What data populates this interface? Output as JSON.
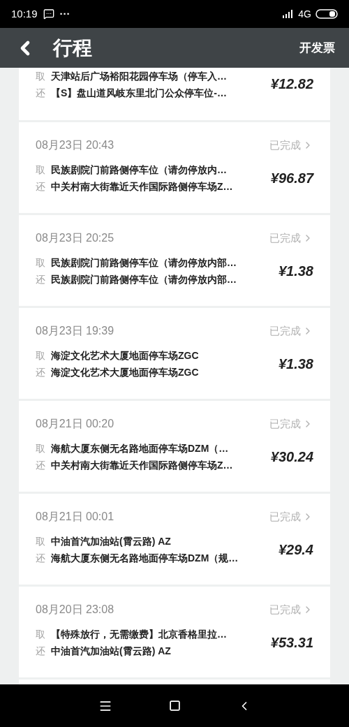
{
  "status_bar": {
    "time": "10:19",
    "more": "···",
    "network": "4G"
  },
  "header": {
    "title": "行程",
    "action": "开发票"
  },
  "first_card": {
    "pickup_label": "取",
    "pickup": "天津站后广场裕阳花园停车场（停车入…",
    "return_label": "还",
    "return": "【S】盘山道风岐东里北门公众停车位-…",
    "price": "¥12.82"
  },
  "trips": [
    {
      "date": "08月23日 20:43",
      "status": "已完成",
      "pickup_label": "取",
      "pickup": "民族剧院门前路侧停车位（请勿停放内…",
      "return_label": "还",
      "return": "中关村南大街靠近天作国际路侧停车场Z…",
      "price": "¥96.87"
    },
    {
      "date": "08月23日 20:25",
      "status": "已完成",
      "pickup_label": "取",
      "pickup": "民族剧院门前路侧停车位（请勿停放内部…",
      "return_label": "还",
      "return": "民族剧院门前路侧停车位（请勿停放内部…",
      "price": "¥1.38"
    },
    {
      "date": "08月23日 19:39",
      "status": "已完成",
      "pickup_label": "取",
      "pickup": "海淀文化艺术大厦地面停车场ZGC",
      "return_label": "还",
      "return": "海淀文化艺术大厦地面停车场ZGC",
      "price": "¥1.38"
    },
    {
      "date": "08月21日 00:20",
      "status": "已完成",
      "pickup_label": "取",
      "pickup": "海航大厦东侧无名路地面停车场DZM（…",
      "return_label": "还",
      "return": "中关村南大街靠近天作国际路侧停车场Z…",
      "price": "¥30.24"
    },
    {
      "date": "08月21日 00:01",
      "status": "已完成",
      "pickup_label": "取",
      "pickup": "中油首汽加油站(霄云路) AZ",
      "return_label": "还",
      "return": "海航大厦东侧无名路地面停车场DZM（规…",
      "price": "¥29.4"
    },
    {
      "date": "08月20日 23:08",
      "status": "已完成",
      "pickup_label": "取",
      "pickup": "【特殊放行，无需缴费】北京香格里拉…",
      "return_label": "还",
      "return": "中油首汽加油站(霄云路) AZ",
      "price": "¥53.31"
    }
  ]
}
